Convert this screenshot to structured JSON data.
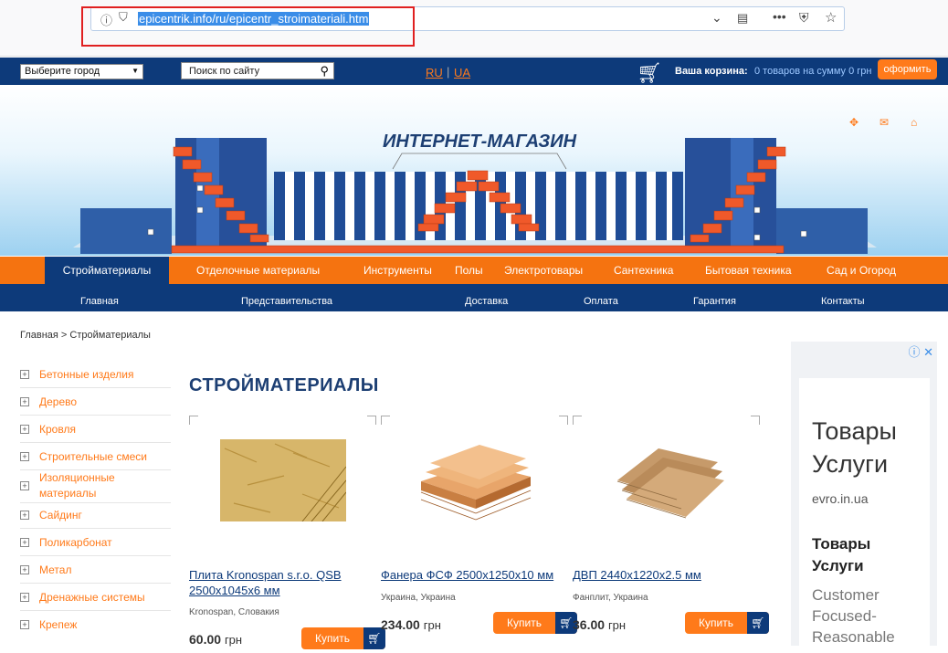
{
  "browser": {
    "url": "epicentrik.info/ru/epicentr_stroimateriali.htm",
    "icons": [
      "info-icon",
      "shield-icon",
      "chevron-down-icon",
      "reader-icon",
      "more-icon",
      "pocket-icon",
      "star-icon"
    ]
  },
  "topbar": {
    "city_select": "Выберите город",
    "search_placeholder": "Поиск по сайту",
    "lang_ru": "RU",
    "lang_ua": "UA",
    "cart_label": "Ваша корзина:",
    "cart_info": "0 товаров на сумму 0 грн",
    "checkout": "оформить"
  },
  "banner": {
    "title": "ИНТЕРНЕТ-МАГАЗИН"
  },
  "categories": [
    "Стройматериалы",
    "Отделочные материалы",
    "Инструменты",
    "Полы",
    "Электротовары",
    "Сантехника",
    "Бытовая техника",
    "Сад и Огород"
  ],
  "subnav": [
    "Главная",
    "Представительства",
    "Доставка",
    "Оплата",
    "Гарантия",
    "Контакты"
  ],
  "breadcrumb": "Главная > Стройматериалы",
  "sidebar": [
    "Бетонные изделия",
    "Дерево",
    "Кровля",
    "Строительные смеси",
    "Изоляционные материалы",
    "Сайдинг",
    "Поликарбонат",
    "Метал",
    "Дренажные системы",
    "Крепеж"
  ],
  "page_title": "СТРОЙМАТЕРИАЛЫ",
  "products": [
    {
      "name": "Плита Kronospan s.r.o. QSB 2500x1045x6 мм",
      "maker": "Kronospan, Словакия",
      "price": "60.00",
      "currency": "грн",
      "buy": "Купить"
    },
    {
      "name": "Фанера ФСФ 2500x1250x10 мм",
      "maker": "Украина, Украина",
      "price": "234.00",
      "currency": "грн",
      "buy": "Купить"
    },
    {
      "name": "ДВП 2440x1220x2.5 мм",
      "maker": "Фанплит, Украина",
      "price": "36.00",
      "currency": "грн",
      "buy": "Купить"
    }
  ],
  "ad": {
    "headline": "Товары Услуги",
    "domain": "evro.in.ua",
    "subheadline": "Товары Услуги",
    "text": "Customer Focused- Reasonable"
  }
}
